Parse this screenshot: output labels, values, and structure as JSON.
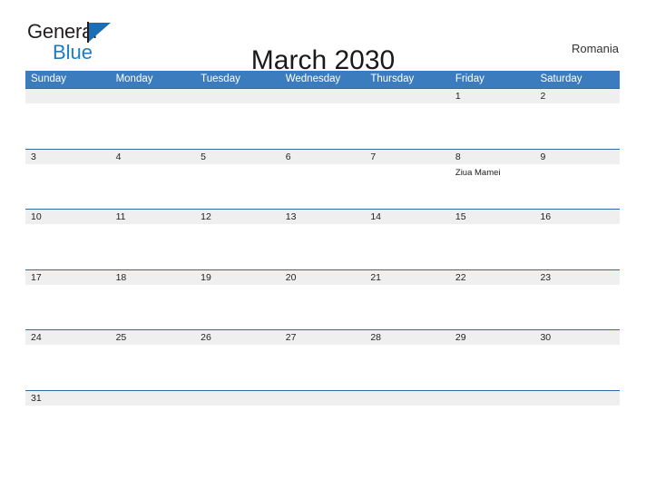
{
  "brand": {
    "name_part1": "General",
    "name_part2": "Blue",
    "flag_icon": "flag-triangle-icon"
  },
  "header": {
    "title": "March 2030",
    "country": "Romania"
  },
  "colors": {
    "header_blue": "#3a7cbe",
    "rule_blue": "#2b6ca8",
    "date_strip_gray": "#efefef",
    "logo_blue": "#1d7dc4"
  },
  "calendar": {
    "weekdays": [
      "Sunday",
      "Monday",
      "Tuesday",
      "Wednesday",
      "Thursday",
      "Friday",
      "Saturday"
    ],
    "weeks": [
      {
        "days": [
          {
            "date": "",
            "event": ""
          },
          {
            "date": "",
            "event": ""
          },
          {
            "date": "",
            "event": ""
          },
          {
            "date": "",
            "event": ""
          },
          {
            "date": "",
            "event": ""
          },
          {
            "date": "1",
            "event": ""
          },
          {
            "date": "2",
            "event": ""
          }
        ]
      },
      {
        "days": [
          {
            "date": "3",
            "event": ""
          },
          {
            "date": "4",
            "event": ""
          },
          {
            "date": "5",
            "event": ""
          },
          {
            "date": "6",
            "event": ""
          },
          {
            "date": "7",
            "event": ""
          },
          {
            "date": "8",
            "event": "Ziua Mamei"
          },
          {
            "date": "9",
            "event": ""
          }
        ]
      },
      {
        "days": [
          {
            "date": "10",
            "event": ""
          },
          {
            "date": "11",
            "event": ""
          },
          {
            "date": "12",
            "event": ""
          },
          {
            "date": "13",
            "event": ""
          },
          {
            "date": "14",
            "event": ""
          },
          {
            "date": "15",
            "event": ""
          },
          {
            "date": "16",
            "event": ""
          }
        ]
      },
      {
        "days": [
          {
            "date": "17",
            "event": ""
          },
          {
            "date": "18",
            "event": ""
          },
          {
            "date": "19",
            "event": ""
          },
          {
            "date": "20",
            "event": ""
          },
          {
            "date": "21",
            "event": ""
          },
          {
            "date": "22",
            "event": ""
          },
          {
            "date": "23",
            "event": ""
          }
        ]
      },
      {
        "days": [
          {
            "date": "24",
            "event": ""
          },
          {
            "date": "25",
            "event": ""
          },
          {
            "date": "26",
            "event": ""
          },
          {
            "date": "27",
            "event": ""
          },
          {
            "date": "28",
            "event": ""
          },
          {
            "date": "29",
            "event": ""
          },
          {
            "date": "30",
            "event": ""
          }
        ]
      },
      {
        "days": [
          {
            "date": "31",
            "event": ""
          },
          {
            "date": "",
            "event": ""
          },
          {
            "date": "",
            "event": ""
          },
          {
            "date": "",
            "event": ""
          },
          {
            "date": "",
            "event": ""
          },
          {
            "date": "",
            "event": ""
          },
          {
            "date": "",
            "event": ""
          }
        ]
      }
    ]
  }
}
